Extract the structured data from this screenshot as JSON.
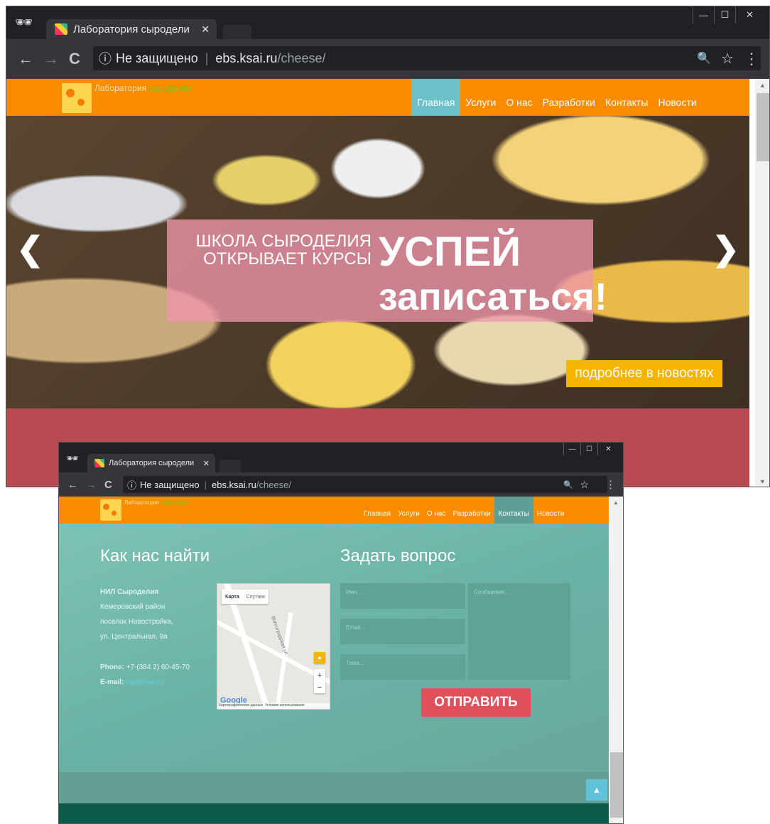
{
  "browser_tab_title": "Лаборатория сыродели",
  "address": {
    "security": "Не защищено",
    "host": "ebs.ksai.ru",
    "path": "/cheese/"
  },
  "window_controls": {
    "minimize": "—",
    "maximize": "☐",
    "close": "✕"
  },
  "icons": {
    "incognito": "🕶",
    "back": "←",
    "forward": "→",
    "reload": "C",
    "info": "ⓘ",
    "zoom": "🔍",
    "star": "☆",
    "menu": "⋮",
    "tab_close": "✕",
    "prev": "❮",
    "next": "❯",
    "scroll_up": "▲",
    "scroll_down": "▼",
    "to_top": "▲"
  },
  "site": {
    "brand": {
      "part1": "Лаборатория",
      "part2": "сыроделия"
    },
    "nav": [
      "Главная",
      "Услуги",
      "О нас",
      "Разработки",
      "Контакты",
      "Новости"
    ]
  },
  "hero": {
    "small_line1": "ШКОЛА СЫРОДЕЛИЯ",
    "small_line2": "ОТКРЫВАЕТ КУРСЫ",
    "big_line1": "УСПЕЙ",
    "big_line2": "записаться!",
    "more_button": "подробнее в новостях"
  },
  "contacts": {
    "title": "Как нас найти",
    "org": "НИЛ Сыроделия",
    "address_lines": [
      "Кемеровский район",
      "поселок Новостройка,",
      "ул. Центральная, 9а"
    ],
    "phone_label": "Phone:",
    "phone": "+7-(384 2) 60-45-70",
    "email_label": "E-mail:",
    "email": "mp@ksai.ru"
  },
  "map": {
    "type_map": "Карта",
    "type_satellite": "Спутник",
    "google": "Google",
    "footer_data": "Картографические данные",
    "footer_terms": "Условия использования",
    "zoom_in": "+",
    "zoom_out": "−",
    "street_label": "Волгоградская ул."
  },
  "form": {
    "title": "Задать вопрос",
    "name_placeholder": "Имя...",
    "email_placeholder": "Email...",
    "subject_placeholder": "Тема...",
    "message_placeholder": "Сообщение...",
    "send": "ОТПРАВИТЬ"
  }
}
